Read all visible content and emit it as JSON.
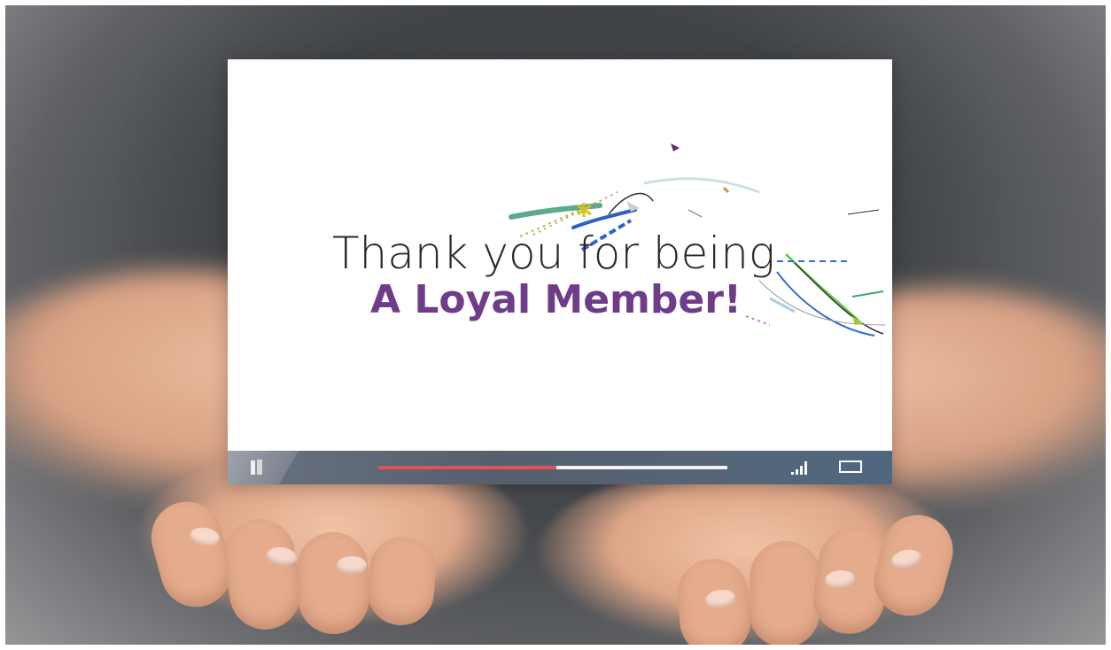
{
  "video": {
    "title_line1": "Thank you for being",
    "title_line2": "A Loyal Member!",
    "progress": 0.51,
    "colors": {
      "line1": "#2a2a2a",
      "line2": "#6f3c89",
      "progress_played": "#e2505a",
      "progress_buffer": "#f2f2f2"
    }
  },
  "controls": {
    "icons": [
      "play-pause-icon",
      "volume-bars-icon",
      "fullscreen-icon"
    ]
  }
}
